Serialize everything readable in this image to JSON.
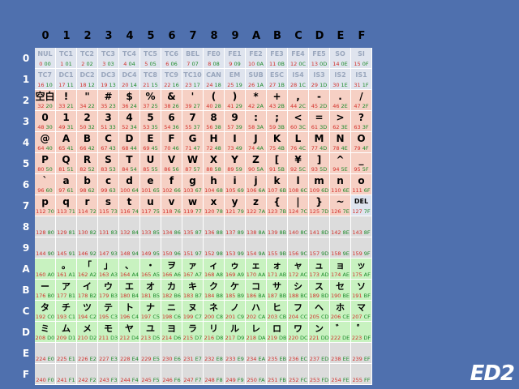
{
  "logo": "ED2",
  "col_headers": [
    "0",
    "1",
    "2",
    "3",
    "4",
    "5",
    "6",
    "7",
    "8",
    "9",
    "A",
    "B",
    "C",
    "D",
    "E",
    "F"
  ],
  "row_headers": [
    "0",
    "1",
    "2",
    "3",
    "4",
    "5",
    "6",
    "7",
    "8",
    "9",
    "A",
    "B",
    "C",
    "D",
    "E",
    "F"
  ],
  "glyphs": [
    [
      "NUL",
      "TC1",
      "TC2",
      "TC3",
      "TC4",
      "TC5",
      "TC6",
      "BEL",
      "FE0",
      "FE1",
      "FE2",
      "FE3",
      "FE4",
      "FE5",
      "SO",
      "SI"
    ],
    [
      "TC7",
      "DC1",
      "DC2",
      "DC3",
      "DC4",
      "TC8",
      "TC9",
      "TC10",
      "CAN",
      "EM",
      "SUB",
      "ESC",
      "IS4",
      "IS3",
      "IS2",
      "IS1"
    ],
    [
      "空白",
      "!",
      "\"",
      "#",
      "$",
      "%",
      "&",
      "'",
      "(",
      ")",
      "*",
      "+",
      ",",
      "-",
      ".",
      "/"
    ],
    [
      "0",
      "1",
      "2",
      "3",
      "4",
      "5",
      "6",
      "7",
      "8",
      "9",
      ":",
      ";",
      "<",
      "=",
      ">",
      "?"
    ],
    [
      "@",
      "A",
      "B",
      "C",
      "D",
      "E",
      "F",
      "G",
      "H",
      "I",
      "J",
      "K",
      "L",
      "M",
      "N",
      "O"
    ],
    [
      "P",
      "Q",
      "R",
      "S",
      "T",
      "U",
      "V",
      "W",
      "X",
      "Y",
      "Z",
      "[",
      "¥",
      "]",
      "^",
      "_"
    ],
    [
      "`",
      "a",
      "b",
      "c",
      "d",
      "e",
      "f",
      "g",
      "h",
      "i",
      "j",
      "k",
      "l",
      "m",
      "n",
      "o"
    ],
    [
      "p",
      "q",
      "r",
      "s",
      "t",
      "u",
      "v",
      "w",
      "x",
      "y",
      "z",
      "{",
      "|",
      "}",
      "~",
      "DEL"
    ],
    [
      "",
      "",
      "",
      "",
      "",
      "",
      "",
      "",
      "",
      "",
      "",
      "",
      "",
      "",
      "",
      ""
    ],
    [
      "",
      "",
      "",
      "",
      "",
      "",
      "",
      "",
      "",
      "",
      "",
      "",
      "",
      "",
      "",
      ""
    ],
    [
      "",
      "。",
      "「",
      "」",
      "、",
      "・",
      "ヲ",
      "ァ",
      "ィ",
      "ゥ",
      "ェ",
      "ォ",
      "ャ",
      "ュ",
      "ョ",
      "ッ"
    ],
    [
      "ー",
      "ア",
      "イ",
      "ウ",
      "エ",
      "オ",
      "カ",
      "キ",
      "ク",
      "ケ",
      "コ",
      "サ",
      "シ",
      "ス",
      "セ",
      "ソ"
    ],
    [
      "タ",
      "チ",
      "ツ",
      "テ",
      "ト",
      "ナ",
      "ニ",
      "ヌ",
      "ネ",
      "ノ",
      "ハ",
      "ヒ",
      "フ",
      "ヘ",
      "ホ",
      "マ"
    ],
    [
      "ミ",
      "ム",
      "メ",
      "モ",
      "ヤ",
      "ユ",
      "ヨ",
      "ラ",
      "リ",
      "ル",
      "レ",
      "ロ",
      "ワ",
      "ン",
      "゛",
      "゜"
    ],
    [
      "",
      "",
      "",
      "",
      "",
      "",
      "",
      "",
      "",
      "",
      "",
      "",
      "",
      "",
      "",
      ""
    ],
    [
      "",
      "",
      "",
      "",
      "",
      "",
      "",
      "",
      "",
      "",
      "",
      "",
      "",
      "",
      "",
      ""
    ]
  ],
  "row_groups": [
    "ctrl",
    "ctrl",
    "ascii",
    "ascii",
    "ascii",
    "ascii",
    "ascii",
    "ascii",
    "empty",
    "empty",
    "kana",
    "kana",
    "kana",
    "kana",
    "empty",
    "empty"
  ],
  "colors": {
    "background": "#4f70ae",
    "ctrl_cell": "#dfe4ee",
    "ascii_cell": "#f6d0c4",
    "empty_cell": "#dcdcdc",
    "kana_cell": "#c8f2c0",
    "decimal_text": "#d2302a",
    "hex_text": "#1c8a2a"
  }
}
